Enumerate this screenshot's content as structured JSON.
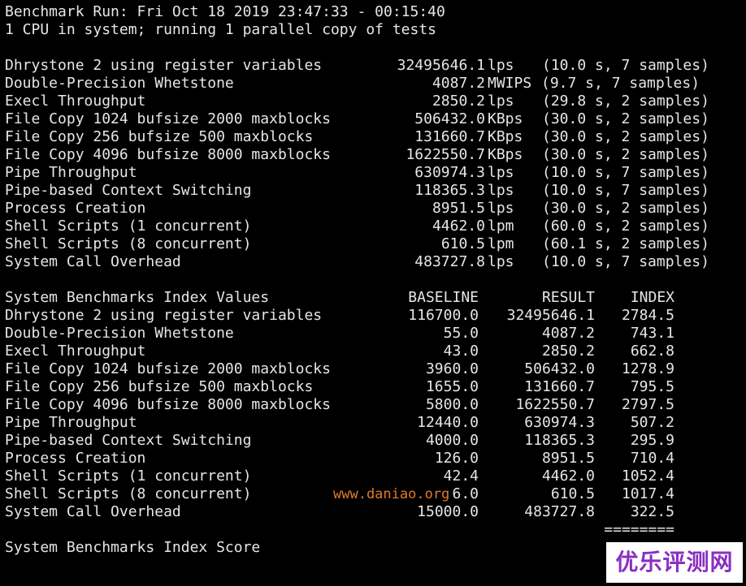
{
  "colors": {
    "background": "#000000",
    "text": "#e6e6e6",
    "watermark_url": "#e07a2a",
    "watermark_logo_text": "#8a2fc2",
    "watermark_logo_bg": "#ffffff"
  },
  "header": {
    "line1": "Benchmark Run: Fri Oct 18 2019 23:47:33 - 00:15:40",
    "line2": "1 CPU in system; running 1 parallel copy of tests"
  },
  "results": [
    {
      "name": "Dhrystone 2 using register variables",
      "value": "32495646.1",
      "unit": "lps",
      "detail": "(10.0 s, 7 samples)"
    },
    {
      "name": "Double-Precision Whetstone",
      "value": "4087.2",
      "unit": "MWIPS",
      "detail": "(9.7 s, 7 samples)"
    },
    {
      "name": "Execl Throughput",
      "value": "2850.2",
      "unit": "lps",
      "detail": "(29.8 s, 2 samples)"
    },
    {
      "name": "File Copy 1024 bufsize 2000 maxblocks",
      "value": "506432.0",
      "unit": "KBps",
      "detail": "(30.0 s, 2 samples)"
    },
    {
      "name": "File Copy 256 bufsize 500 maxblocks",
      "value": "131660.7",
      "unit": "KBps",
      "detail": "(30.0 s, 2 samples)"
    },
    {
      "name": "File Copy 4096 bufsize 8000 maxblocks",
      "value": "1622550.7",
      "unit": "KBps",
      "detail": "(30.0 s, 2 samples)"
    },
    {
      "name": "Pipe Throughput",
      "value": "630974.3",
      "unit": "lps",
      "detail": "(10.0 s, 7 samples)"
    },
    {
      "name": "Pipe-based Context Switching",
      "value": "118365.3",
      "unit": "lps",
      "detail": "(10.0 s, 7 samples)"
    },
    {
      "name": "Process Creation",
      "value": "8951.5",
      "unit": "lps",
      "detail": "(30.0 s, 2 samples)"
    },
    {
      "name": "Shell Scripts (1 concurrent)",
      "value": "4462.0",
      "unit": "lpm",
      "detail": "(60.0 s, 2 samples)"
    },
    {
      "name": "Shell Scripts (8 concurrent)",
      "value": "610.5",
      "unit": "lpm",
      "detail": "(60.1 s, 2 samples)"
    },
    {
      "name": "System Call Overhead",
      "value": "483727.8",
      "unit": "lps",
      "detail": "(10.0 s, 7 samples)"
    }
  ],
  "index_table": {
    "title": "System Benchmarks Index Values",
    "columns": [
      "BASELINE",
      "RESULT",
      "INDEX"
    ],
    "rows": [
      {
        "name": "Dhrystone 2 using register variables",
        "baseline": "116700.0",
        "result": "32495646.1",
        "index": "2784.5"
      },
      {
        "name": "Double-Precision Whetstone",
        "baseline": "55.0",
        "result": "4087.2",
        "index": "743.1"
      },
      {
        "name": "Execl Throughput",
        "baseline": "43.0",
        "result": "2850.2",
        "index": "662.8"
      },
      {
        "name": "File Copy 1024 bufsize 2000 maxblocks",
        "baseline": "3960.0",
        "result": "506432.0",
        "index": "1278.9"
      },
      {
        "name": "File Copy 256 bufsize 500 maxblocks",
        "baseline": "1655.0",
        "result": "131660.7",
        "index": "795.5"
      },
      {
        "name": "File Copy 4096 bufsize 8000 maxblocks",
        "baseline": "5800.0",
        "result": "1622550.7",
        "index": "2797.5"
      },
      {
        "name": "Pipe Throughput",
        "baseline": "12440.0",
        "result": "630974.3",
        "index": "507.2"
      },
      {
        "name": "Pipe-based Context Switching",
        "baseline": "4000.0",
        "result": "118365.3",
        "index": "295.9"
      },
      {
        "name": "Process Creation",
        "baseline": "126.0",
        "result": "8951.5",
        "index": "710.4"
      },
      {
        "name": "Shell Scripts (1 concurrent)",
        "baseline": "42.4",
        "result": "4462.0",
        "index": "1052.4"
      },
      {
        "name": "Shell Scripts (8 concurrent)",
        "baseline": "6.0",
        "result": "610.5",
        "index": "1017.4"
      },
      {
        "name": "System Call Overhead",
        "baseline": "15000.0",
        "result": "483727.8",
        "index": "322.5"
      }
    ],
    "separator": "========",
    "score_label": "System Benchmarks Index Score"
  },
  "watermark": {
    "url": "www.daniao.org",
    "logo": "优乐评测网"
  }
}
